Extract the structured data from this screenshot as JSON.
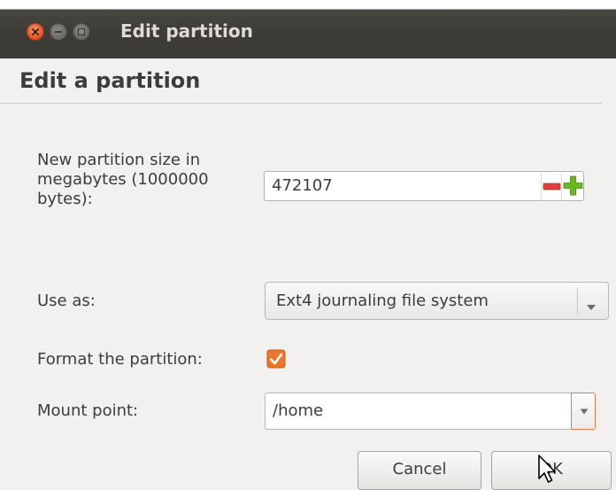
{
  "window": {
    "title": "Edit partition",
    "close_color": "#e2512a",
    "titlebar_color": "#3c3b37"
  },
  "dialog": {
    "heading": "Edit a partition"
  },
  "form": {
    "size_label": "New partition size in megabytes (1000000 bytes):",
    "size_value": "472107",
    "use_as_label": "Use as:",
    "use_as_value": "Ext4 journaling file system",
    "format_label": "Format the partition:",
    "format_checked": true,
    "mount_label": "Mount point:",
    "mount_value": "/home"
  },
  "buttons": {
    "cancel": "Cancel",
    "ok": "OK"
  },
  "icons": {
    "close": "close-icon",
    "minimize": "minimize-icon",
    "maximize": "maximize-icon",
    "decrement": "minus-icon",
    "increment": "plus-icon",
    "dropdown": "chevron-down-icon",
    "checkbox": "checkmark-icon",
    "cursor": "mouse-pointer-icon"
  },
  "colors": {
    "accent": "#e9772f",
    "minus_red": "#e2403a",
    "plus_green": "#68b723"
  }
}
